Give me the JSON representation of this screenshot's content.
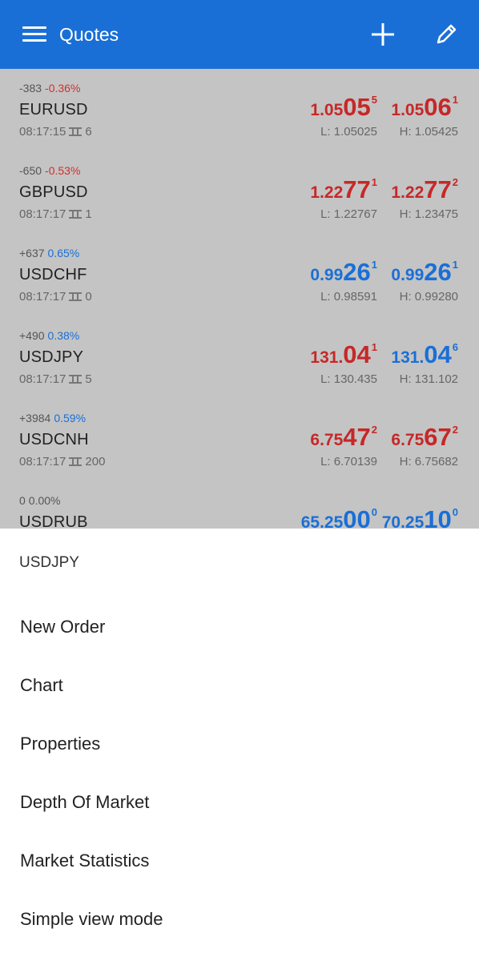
{
  "appbar": {
    "title": "Quotes",
    "color": "#1a6fd6"
  },
  "quotes": [
    {
      "change_abs": "-383",
      "change_pct": "-0.36%",
      "direction": "neg",
      "symbol": "EURUSD",
      "time": "08:17:15",
      "spread": "6",
      "bid": {
        "small": "1.05",
        "big": "05",
        "sup": "5",
        "color": "red"
      },
      "ask": {
        "small": "1.05",
        "big": "06",
        "sup": "1",
        "color": "red"
      },
      "low": "L: 1.05025",
      "high": "H: 1.05425"
    },
    {
      "change_abs": "-650",
      "change_pct": "-0.53%",
      "direction": "neg",
      "symbol": "GBPUSD",
      "time": "08:17:17",
      "spread": "1",
      "bid": {
        "small": "1.22",
        "big": "77",
        "sup": "1",
        "color": "red"
      },
      "ask": {
        "small": "1.22",
        "big": "77",
        "sup": "2",
        "color": "red"
      },
      "low": "L: 1.22767",
      "high": "H: 1.23475"
    },
    {
      "change_abs": "+637",
      "change_pct": "0.65%",
      "direction": "pos",
      "symbol": "USDCHF",
      "time": "08:17:17",
      "spread": "0",
      "bid": {
        "small": "0.99",
        "big": "26",
        "sup": "1",
        "color": "blue"
      },
      "ask": {
        "small": "0.99",
        "big": "26",
        "sup": "1",
        "color": "blue"
      },
      "low": "L: 0.98591",
      "high": "H: 0.99280"
    },
    {
      "change_abs": "+490",
      "change_pct": "0.38%",
      "direction": "pos",
      "symbol": "USDJPY",
      "time": "08:17:17",
      "spread": "5",
      "bid": {
        "small": "131.",
        "big": "04",
        "sup": "1",
        "color": "red"
      },
      "ask": {
        "small": "131.",
        "big": "04",
        "sup": "6",
        "color": "blue"
      },
      "low": "L: 130.435",
      "high": "H: 131.102"
    },
    {
      "change_abs": "+3984",
      "change_pct": "0.59%",
      "direction": "pos",
      "symbol": "USDCNH",
      "time": "08:17:17",
      "spread": "200",
      "bid": {
        "small": "6.75",
        "big": "47",
        "sup": "2",
        "color": "red"
      },
      "ask": {
        "small": "6.75",
        "big": "67",
        "sup": "2",
        "color": "red"
      },
      "low": "L: 6.70139",
      "high": "H: 6.75682"
    },
    {
      "change_abs": "0",
      "change_pct": "0.00%",
      "direction": "flat",
      "symbol": "USDRUB",
      "time": "",
      "spread": "",
      "bid": {
        "small": "65.25",
        "big": "00",
        "sup": "0",
        "color": "blue"
      },
      "ask": {
        "small": "70.25",
        "big": "10",
        "sup": "0",
        "color": "blue"
      },
      "low": "",
      "high": ""
    }
  ],
  "sheet": {
    "title": "USDJPY",
    "items": [
      "New Order",
      "Chart",
      "Properties",
      "Depth Of Market",
      "Market Statistics",
      "Simple view mode"
    ]
  }
}
